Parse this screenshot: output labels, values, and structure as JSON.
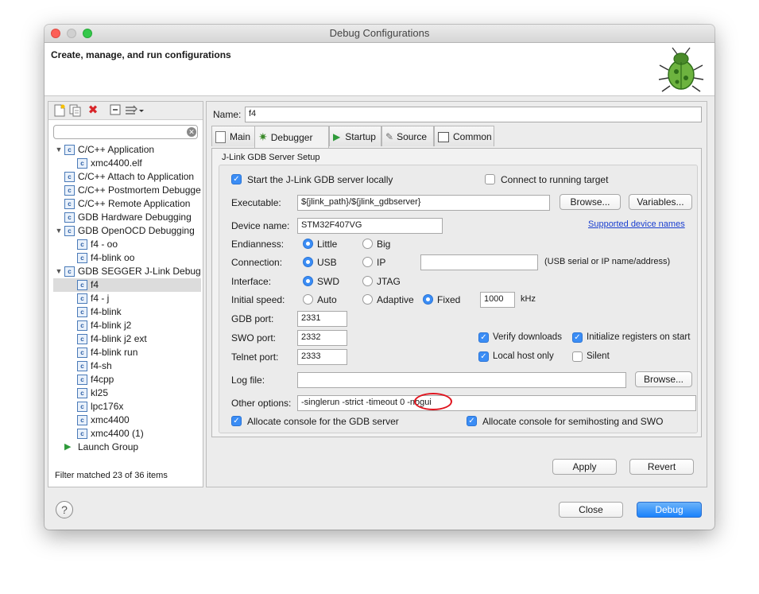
{
  "window": {
    "title": "Debug Configurations"
  },
  "header": {
    "title": "Create, manage, and run configurations"
  },
  "toolbar": {
    "icons": [
      "new-config-icon",
      "duplicate-icon",
      "delete-icon",
      "collapse-all-icon",
      "filter-icon"
    ]
  },
  "filter": {
    "value": "",
    "placeholder": ""
  },
  "tree": {
    "groups": [
      {
        "label": "C/C++ Application",
        "expanded": true,
        "children": [
          "xmc4400.elf"
        ]
      },
      {
        "label": "C/C++ Attach to Application",
        "expanded": false,
        "children": []
      },
      {
        "label": "C/C++ Postmortem Debugger",
        "expanded": false,
        "children": []
      },
      {
        "label": "C/C++ Remote Application",
        "expanded": false,
        "children": []
      },
      {
        "label": "GDB Hardware Debugging",
        "expanded": false,
        "children": []
      },
      {
        "label": "GDB OpenOCD Debugging",
        "expanded": true,
        "children": [
          "f4 - oo",
          "f4-blink oo"
        ]
      },
      {
        "label": "GDB SEGGER J-Link Debugging",
        "expanded": true,
        "children": [
          "f4",
          "f4 - j",
          "f4-blink",
          "f4-blink j2",
          "f4-blink j2 ext",
          "f4-blink run",
          "f4-sh",
          "f4cpp",
          "kl25",
          "lpc176x",
          "xmc4400",
          "xmc4400 (1)"
        ]
      },
      {
        "label": "Launch Group",
        "expanded": false,
        "children": []
      }
    ],
    "selected": "f4",
    "filter_status": "Filter matched 23 of 36 items"
  },
  "name": {
    "label": "Name:",
    "value": "f4"
  },
  "tabs": [
    "Main",
    "Debugger",
    "Startup",
    "Source",
    "Common"
  ],
  "active_tab": "Debugger",
  "server_setup": {
    "group_title": "J-Link GDB Server Setup",
    "start_locally": {
      "label": "Start the J-Link GDB server locally",
      "checked": true
    },
    "connect_running": {
      "label": "Connect to running target",
      "checked": false
    },
    "executable": {
      "label": "Executable:",
      "value": "${jlink_path}/${jlink_gdbserver}",
      "browse": "Browse...",
      "variables": "Variables..."
    },
    "device": {
      "label": "Device name:",
      "value": "STM32F407VG",
      "link": "Supported device names"
    },
    "endianness": {
      "label": "Endianness:",
      "options": [
        "Little",
        "Big"
      ],
      "selected": "Little"
    },
    "connection": {
      "label": "Connection:",
      "options": [
        "USB",
        "IP"
      ],
      "selected": "USB",
      "address_value": "",
      "hint": "(USB serial or IP name/address)"
    },
    "interface": {
      "label": "Interface:",
      "options": [
        "SWD",
        "JTAG"
      ],
      "selected": "SWD"
    },
    "speed": {
      "label": "Initial speed:",
      "options": [
        "Auto",
        "Adaptive",
        "Fixed"
      ],
      "selected": "Fixed",
      "value": "1000",
      "unit": "kHz"
    },
    "gdb_port": {
      "label": "GDB port:",
      "value": "2331"
    },
    "swo_port": {
      "label": "SWO port:",
      "value": "2332"
    },
    "telnet_port": {
      "label": "Telnet port:",
      "value": "2333"
    },
    "verify_downloads": {
      "label": "Verify downloads",
      "checked": true
    },
    "init_registers": {
      "label": "Initialize registers on start",
      "checked": true
    },
    "local_host_only": {
      "label": "Local host only",
      "checked": true
    },
    "silent": {
      "label": "Silent",
      "checked": false
    },
    "log_file": {
      "label": "Log file:",
      "value": "",
      "browse": "Browse..."
    },
    "other_options": {
      "label": "Other options:",
      "value": "-singlerun -strict -timeout 0 -nogui",
      "highlight": "-nogui",
      "highlight_color": "#e0141e"
    },
    "console_gdb": {
      "label": "Allocate console for the GDB server",
      "checked": true
    },
    "console_semihosting": {
      "label": "Allocate console for semihosting and SWO",
      "checked": true
    }
  },
  "buttons": {
    "apply": "Apply",
    "revert": "Revert",
    "close": "Close",
    "debug": "Debug",
    "help": "?"
  },
  "colors": {
    "accent": "#3b8df5",
    "link": "#1a3fd0",
    "traffic_close": "#fc5f57",
    "traffic_min": "#d0d0d0",
    "traffic_max": "#34c84a"
  }
}
